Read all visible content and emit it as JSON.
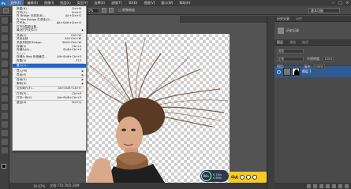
{
  "menubar": {
    "logo": "Ps",
    "items": [
      "文件(F)",
      "编辑(E)",
      "图像(I)",
      "图层(L)",
      "类型(Y)",
      "选择(S)",
      "滤镜(T)",
      "3D(D)",
      "视图(V)",
      "窗口(W)",
      "帮助(H)"
    ],
    "window_controls": [
      "–",
      "□",
      "✕"
    ]
  },
  "options": {
    "zoom_value": "0%",
    "text": "□ 细微缩放",
    "workspace": "基本功能"
  },
  "panels": {
    "history_tabs": [
      "历史记录",
      "动作"
    ],
    "history_item": "历史记录",
    "layers_tabs": [
      "图层",
      "通道",
      "路径"
    ],
    "kind_filter": "类型",
    "blend_mode": "正常",
    "opacity_label": "不透明度:",
    "opacity_value": "100%",
    "lock_label": "锁定:",
    "fill_label": "填充:",
    "fill_value": "100%",
    "layer_name": "图层 1"
  },
  "file_menu": {
    "groups": [
      [
        {
          "label": "新建(N)...",
          "shortcut": "Ctrl+N"
        },
        {
          "label": "打开(O)...",
          "shortcut": "Ctrl+O"
        },
        {
          "label": "在 Bridge 中浏览(B)...",
          "shortcut": "Alt+Ctrl+O"
        },
        {
          "label": "在 Mini Bridge 中浏览(G)...",
          "shortcut": ""
        },
        {
          "label": "打开为...",
          "shortcut": "Alt+Shift+Ctrl+O"
        },
        {
          "label": "打开为智能对象...",
          "shortcut": ""
        },
        {
          "label": "最近打开文件(T)",
          "shortcut": "",
          "submenu": true
        }
      ],
      [
        {
          "label": "关闭(C)",
          "shortcut": "Ctrl+W"
        },
        {
          "label": "关闭全部",
          "shortcut": "Alt+Ctrl+W"
        },
        {
          "label": "关闭并转到 Bridge...",
          "shortcut": "Shift+Ctrl+W"
        },
        {
          "label": "存储(S)",
          "shortcut": "Ctrl+S"
        },
        {
          "label": "存储为(A)...",
          "shortcut": "Shift+Ctrl+S"
        },
        {
          "label": "签入(I)...",
          "shortcut": "",
          "disabled": true
        },
        {
          "label": "存储为 Web 所用格式...",
          "shortcut": "Alt+Shift+Ctrl+S"
        },
        {
          "label": "恢复(V)",
          "shortcut": "F12"
        }
      ],
      [
        {
          "label": "置入(L)...",
          "shortcut": "",
          "highlighted": true
        }
      ],
      [
        {
          "label": "导入(M)",
          "shortcut": "",
          "submenu": true
        },
        {
          "label": "导出(E)",
          "shortcut": "",
          "submenu": true
        }
      ],
      [
        {
          "label": "自动(U)",
          "shortcut": "",
          "submenu": true
        },
        {
          "label": "脚本(R)",
          "shortcut": "",
          "submenu": true
        }
      ],
      [
        {
          "label": "文件简介(F)...",
          "shortcut": "Alt+Shift+Ctrl+I"
        }
      ],
      [
        {
          "label": "打印(P)...",
          "shortcut": "Ctrl+P"
        },
        {
          "label": "打印一份(Y)",
          "shortcut": "Alt+Shift+Ctrl+P"
        }
      ],
      [
        {
          "label": "退出(X)",
          "shortcut": "Ctrl+Q"
        }
      ]
    ]
  },
  "statusbar": {
    "zoom": "16.67%",
    "doc": "文档:770.7K/2.26M"
  },
  "widgets": {
    "perf_value": "88",
    "perf_unit": "%",
    "perf_line1": "0.1K/s",
    "perf_line2": "0.6K/s",
    "yellow_text": "中A"
  }
}
